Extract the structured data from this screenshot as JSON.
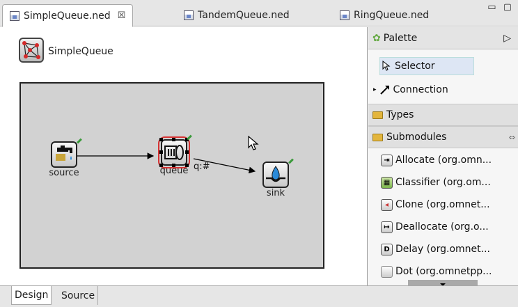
{
  "tabs": [
    {
      "label": "SimpleQueue.ned",
      "close": "☒"
    },
    {
      "label": "TandemQueue.ned"
    },
    {
      "label": "RingQueue.ned"
    }
  ],
  "window_controls": "▭ ▢",
  "network": {
    "name": "SimpleQueue"
  },
  "modules": {
    "source": "source",
    "queue": "queue",
    "sink": "sink"
  },
  "connection_label": "q:#",
  "palette": {
    "title": "Palette",
    "collapse": "▷",
    "selector": "Selector",
    "connection": "Connection",
    "types": "Types",
    "submodules": "Submodules",
    "items": [
      {
        "label": "Allocate (org.omn...",
        "icon": "allocate-icon",
        "glyph": "⇥"
      },
      {
        "label": "Classifier (org.om...",
        "icon": "classifier-icon",
        "glyph": "▦"
      },
      {
        "label": "Clone (org.omnet...",
        "icon": "clone-icon",
        "glyph": "◂"
      },
      {
        "label": "Deallocate (org.o...",
        "icon": "deallocate-icon",
        "glyph": "↦"
      },
      {
        "label": "Delay (org.omnet...",
        "icon": "delay-icon",
        "glyph": "D"
      },
      {
        "label": "Dot (org.omnetpp...",
        "icon": "dot-icon",
        "glyph": ""
      }
    ]
  },
  "bottom_tabs": [
    "Design",
    "Source"
  ]
}
